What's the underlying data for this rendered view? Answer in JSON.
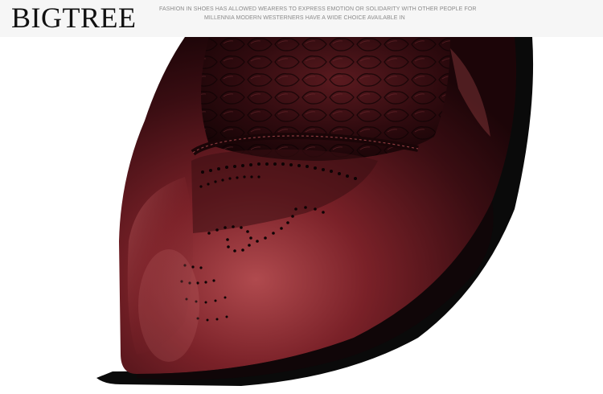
{
  "header": {
    "brand": "BIGTREE",
    "tagline_line1": "FASHION IN SHOES HAS ALLOWED WEARERS TO EXPRESS EMOTION OR SOLIDARITY WITH OTHER PEOPLE FOR",
    "tagline_line2": "MILLENNIA MODERN WESTERNERS HAVE A WIDE CHOICE AVAILABLE IN"
  },
  "photo": {
    "subject": "burgundy brogue dress shoe close-up",
    "colors": {
      "leather_dark": "#2a0a0e",
      "leather_mid": "#6e1c22",
      "leather_light": "#b04a4e",
      "sole": "#0a0a0a",
      "background": "#ffffff"
    }
  }
}
